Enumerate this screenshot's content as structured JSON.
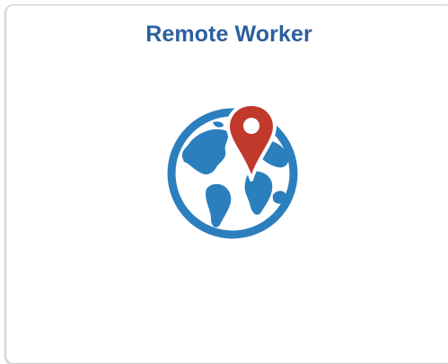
{
  "tile": {
    "title": "Remote Worker",
    "icon": "globe-location-pin-icon"
  },
  "colors": {
    "title": "#2c5f9e",
    "globe": "#2b7fbd",
    "pin": "#c0392b",
    "border": "#c9c9c9"
  }
}
